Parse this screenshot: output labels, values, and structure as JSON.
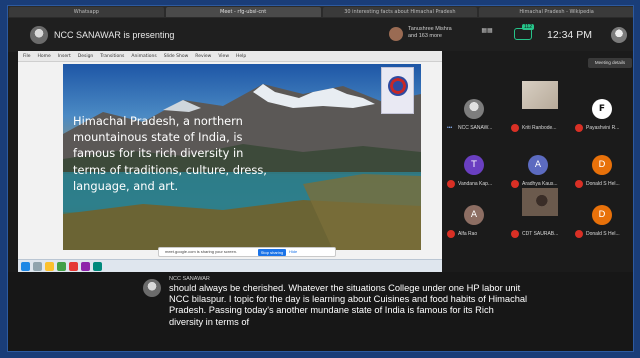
{
  "browser": {
    "tabs": [
      "Whatsapp",
      "Meet - rfg-ubsl-cnt",
      "30 interesting facts about Himachal Pradesh",
      "Himachal Pradesh - Wikipedia"
    ]
  },
  "topbar": {
    "presenter_text": "NCC SANAWAR is presenting",
    "share_text": "Tanushree Mishra and 163 more",
    "chat_badge": "112",
    "clock": "12:34 PM"
  },
  "presentation": {
    "menu": [
      "File",
      "Home",
      "Insert",
      "Design",
      "Transitions",
      "Animations",
      "Slide Show",
      "Review",
      "View",
      "Help"
    ],
    "slide_text": "Himachal Pradesh, a northern mountainous state of India, is famous for its rich diversity in terms of traditions, culture, dress, language, and art.",
    "share_bar": {
      "message": "meet.google.com is sharing your screen.",
      "stop_label": "Stop sharing",
      "hide_label": "Hide"
    }
  },
  "sidebar": {
    "meeting_details_label": "Meeting details",
    "participants": [
      {
        "name": "NCC SANAW...",
        "initial": "",
        "avatar_color": "",
        "type": "photo",
        "muted": false
      },
      {
        "name": "Kriti Ranbode...",
        "initial": "",
        "avatar_color": "",
        "type": "video",
        "muted": true
      },
      {
        "name": "Payashvini R...",
        "initial": "F",
        "avatar_color": "#ffffff",
        "type": "letter",
        "muted": true
      },
      {
        "name": "Vandana Kap...",
        "initial": "T",
        "avatar_color": "#6a3fc1",
        "type": "letter",
        "muted": true
      },
      {
        "name": "Aradhya Kaus...",
        "initial": "A",
        "avatar_color": "#5c6bc0",
        "type": "letter",
        "muted": true
      },
      {
        "name": "Donald S Hel...",
        "initial": "D",
        "avatar_color": "#e8710a",
        "type": "letter",
        "muted": true
      },
      {
        "name": "Alfa Rao",
        "initial": "A",
        "avatar_color": "#8d6e63",
        "type": "letter",
        "muted": true
      },
      {
        "name": "CDT SAURAB...",
        "initial": "",
        "avatar_color": "",
        "type": "video",
        "muted": true
      },
      {
        "name": "Donald S Hel...",
        "initial": "D",
        "avatar_color": "#e8710a",
        "type": "letter",
        "muted": true
      }
    ]
  },
  "caption": {
    "speaker": "NCC SANAWAR",
    "text": "should always be cherished. Whatever the situations College under one HP labor unit NCC bilaspur. I topic for the day is learning about Cuisines and food habits of Himachal Pradesh. Passing today's another mundane state of India is famous for its Rich diversity in terms of"
  }
}
